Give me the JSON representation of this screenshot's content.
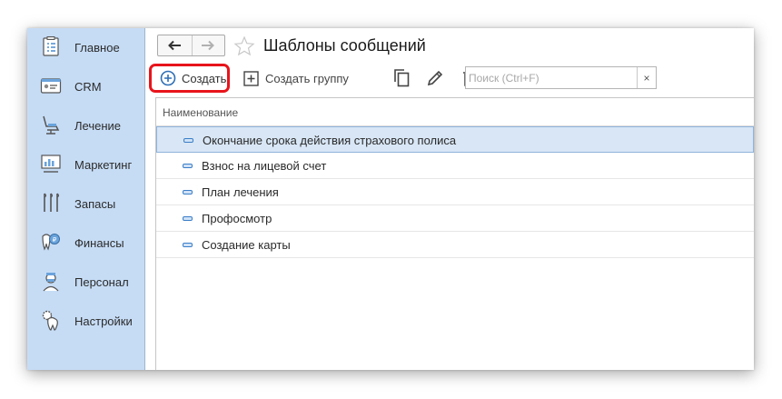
{
  "sidebar": {
    "items": [
      {
        "label": "Главное",
        "icon": "dental-chart-icon"
      },
      {
        "label": "CRM",
        "icon": "id-card-icon"
      },
      {
        "label": "Лечение",
        "icon": "dental-chair-icon"
      },
      {
        "label": "Маркетинг",
        "icon": "presentation-board-icon"
      },
      {
        "label": "Запасы",
        "icon": "dental-tools-icon"
      },
      {
        "label": "Финансы",
        "icon": "tooth-coin-icon"
      },
      {
        "label": "Персонал",
        "icon": "doctor-icon"
      },
      {
        "label": "Настройки",
        "icon": "tooth-gear-icon"
      }
    ]
  },
  "header": {
    "title": "Шаблоны сообщений",
    "back_icon": "arrow-left-icon",
    "forward_icon": "arrow-right-icon",
    "favorite_icon": "star-icon"
  },
  "toolbar": {
    "create_label": "Создать",
    "create_group_label": "Создать группу",
    "copy_icon": "copy-icon",
    "edit_icon": "pencil-icon",
    "delete_icon": "trash-icon"
  },
  "search": {
    "placeholder": "Поиск (Ctrl+F)",
    "value": "",
    "clear_label": "×"
  },
  "table": {
    "column_header": "Наименование",
    "rows": [
      {
        "name": "Окончание срока действия страхового полиса",
        "selected": true
      },
      {
        "name": "Взнос на лицевой счет",
        "selected": false
      },
      {
        "name": "План лечения",
        "selected": false
      },
      {
        "name": "Профосмотр",
        "selected": false
      },
      {
        "name": "Создание карты",
        "selected": false
      }
    ]
  },
  "colors": {
    "sidebar_bg": "#c6dcf5",
    "highlight": "#e8141b",
    "selected_row": "#d8e6f5",
    "accent": "#3b7ec7"
  }
}
